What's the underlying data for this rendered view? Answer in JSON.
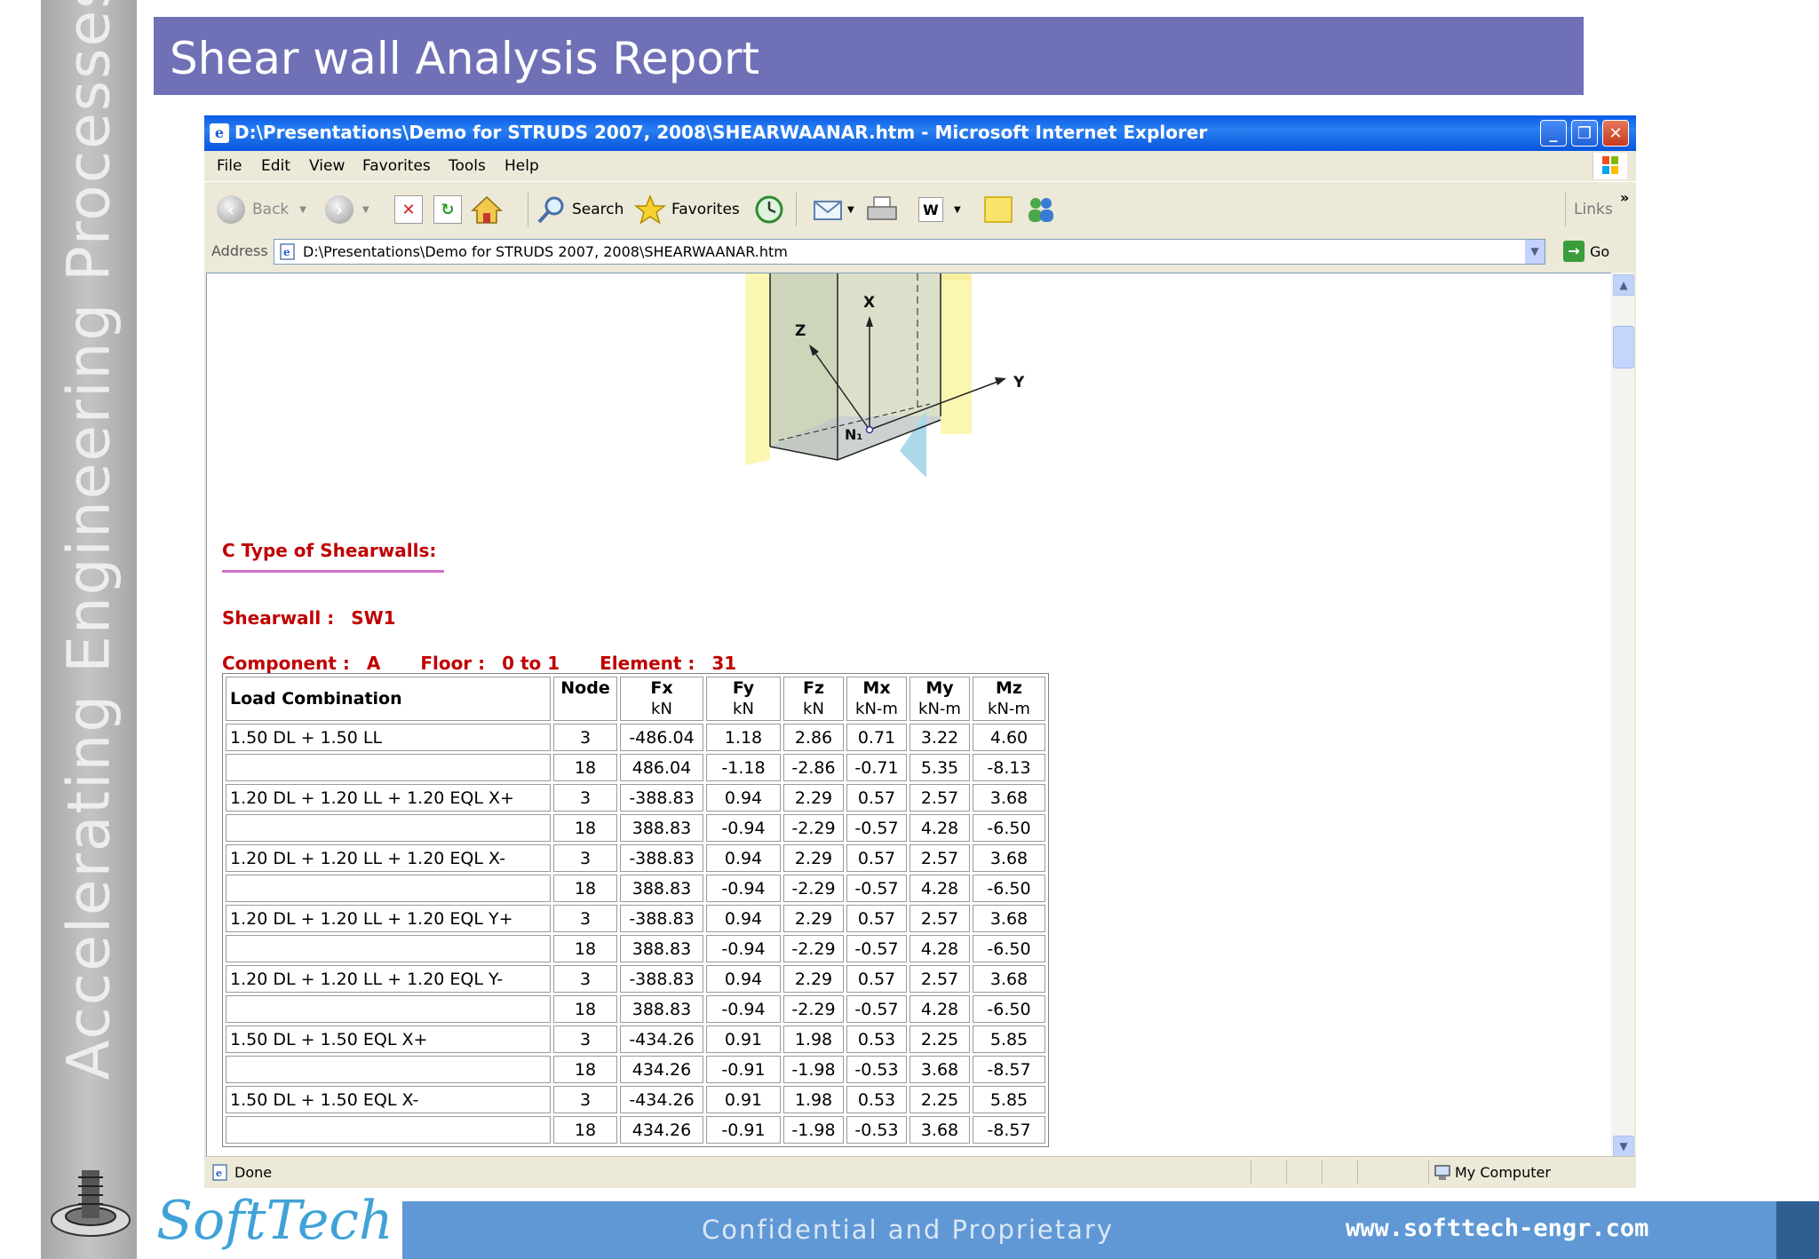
{
  "slide": {
    "title": "Shear wall Analysis Report",
    "side_text": "Accelerating Engineering Processes",
    "footer_text": "Confidential and Proprietary",
    "website": "www.softtech-engr.com",
    "brand": "SoftTech"
  },
  "browser": {
    "window_title": "D:\\Presentations\\Demo for STRUDS 2007, 2008\\SHEARWAANAR.htm - Microsoft Internet Explorer",
    "menu": [
      "File",
      "Edit",
      "View",
      "Favorites",
      "Tools",
      "Help"
    ],
    "toolbar": {
      "back": "Back",
      "search": "Search",
      "favorites": "Favorites",
      "links": "Links"
    },
    "address_label": "Address",
    "address_value": "D:\\Presentations\\Demo for STRUDS 2007, 2008\\SHEARWAANAR.htm",
    "go": "Go",
    "status_left": "Done",
    "status_right": "My Computer"
  },
  "page": {
    "diagram_labels": {
      "x": "X",
      "y": "Y",
      "z": "Z",
      "n": "N₁"
    },
    "section_heading": "C Type of Shearwalls:",
    "shearwall_label": "Shearwall :",
    "shearwall_value": "SW1",
    "component_label": "Component :",
    "component_value": "A",
    "floor_label": "Floor :",
    "floor_value": "0 to 1",
    "element_label": "Element :",
    "element_value": "31",
    "table": {
      "headers": [
        {
          "name": "Load Combination",
          "unit": ""
        },
        {
          "name": "Node",
          "unit": ""
        },
        {
          "name": "Fx",
          "unit": "kN"
        },
        {
          "name": "Fy",
          "unit": "kN"
        },
        {
          "name": "Fz",
          "unit": "kN"
        },
        {
          "name": "Mx",
          "unit": "kN-m"
        },
        {
          "name": "My",
          "unit": "kN-m"
        },
        {
          "name": "Mz",
          "unit": "kN-m"
        }
      ],
      "rows": [
        [
          "1.50 DL + 1.50 LL",
          "3",
          "-486.04",
          "1.18",
          "2.86",
          "0.71",
          "3.22",
          "4.60"
        ],
        [
          "",
          "18",
          "486.04",
          "-1.18",
          "-2.86",
          "-0.71",
          "5.35",
          "-8.13"
        ],
        [
          "1.20 DL + 1.20 LL + 1.20 EQL X+",
          "3",
          "-388.83",
          "0.94",
          "2.29",
          "0.57",
          "2.57",
          "3.68"
        ],
        [
          "",
          "18",
          "388.83",
          "-0.94",
          "-2.29",
          "-0.57",
          "4.28",
          "-6.50"
        ],
        [
          "1.20 DL + 1.20 LL + 1.20 EQL X-",
          "3",
          "-388.83",
          "0.94",
          "2.29",
          "0.57",
          "2.57",
          "3.68"
        ],
        [
          "",
          "18",
          "388.83",
          "-0.94",
          "-2.29",
          "-0.57",
          "4.28",
          "-6.50"
        ],
        [
          "1.20 DL + 1.20 LL + 1.20 EQL Y+",
          "3",
          "-388.83",
          "0.94",
          "2.29",
          "0.57",
          "2.57",
          "3.68"
        ],
        [
          "",
          "18",
          "388.83",
          "-0.94",
          "-2.29",
          "-0.57",
          "4.28",
          "-6.50"
        ],
        [
          "1.20 DL + 1.20 LL + 1.20 EQL Y-",
          "3",
          "-388.83",
          "0.94",
          "2.29",
          "0.57",
          "2.57",
          "3.68"
        ],
        [
          "",
          "18",
          "388.83",
          "-0.94",
          "-2.29",
          "-0.57",
          "4.28",
          "-6.50"
        ],
        [
          "1.50 DL + 1.50 EQL X+",
          "3",
          "-434.26",
          "0.91",
          "1.98",
          "0.53",
          "2.25",
          "5.85"
        ],
        [
          "",
          "18",
          "434.26",
          "-0.91",
          "-1.98",
          "-0.53",
          "3.68",
          "-8.57"
        ],
        [
          "1.50 DL + 1.50 EQL X-",
          "3",
          "-434.26",
          "0.91",
          "1.98",
          "0.53",
          "2.25",
          "5.85"
        ],
        [
          "",
          "18",
          "434.26",
          "-0.91",
          "-1.98",
          "-0.53",
          "3.68",
          "-8.57"
        ]
      ]
    }
  },
  "colors": {
    "title_bar": "#7070b7",
    "heading_red": "#c00000",
    "footer_blue": "#5f98d5",
    "xp_title_blue": "#0a5be6"
  }
}
